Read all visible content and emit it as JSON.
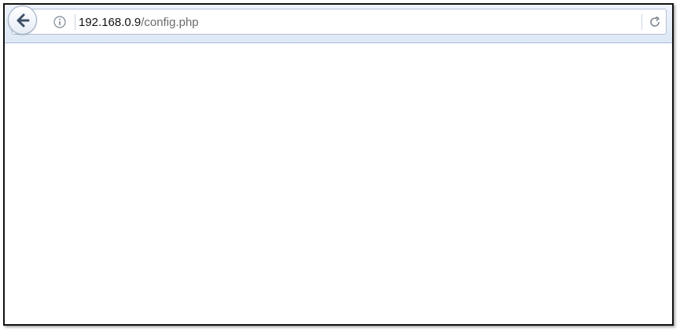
{
  "browser": {
    "address_bar": {
      "url_host": "192.168.0.9",
      "url_path": "/config.php"
    },
    "icons": {
      "back": "back-arrow-icon",
      "site_info": "info-icon",
      "reload": "reload-icon"
    }
  },
  "colors": {
    "toolbar_bg": "#dde8f6",
    "url_host_text": "#111111",
    "url_path_text": "#6b6b6b",
    "frame_border": "#111111"
  }
}
